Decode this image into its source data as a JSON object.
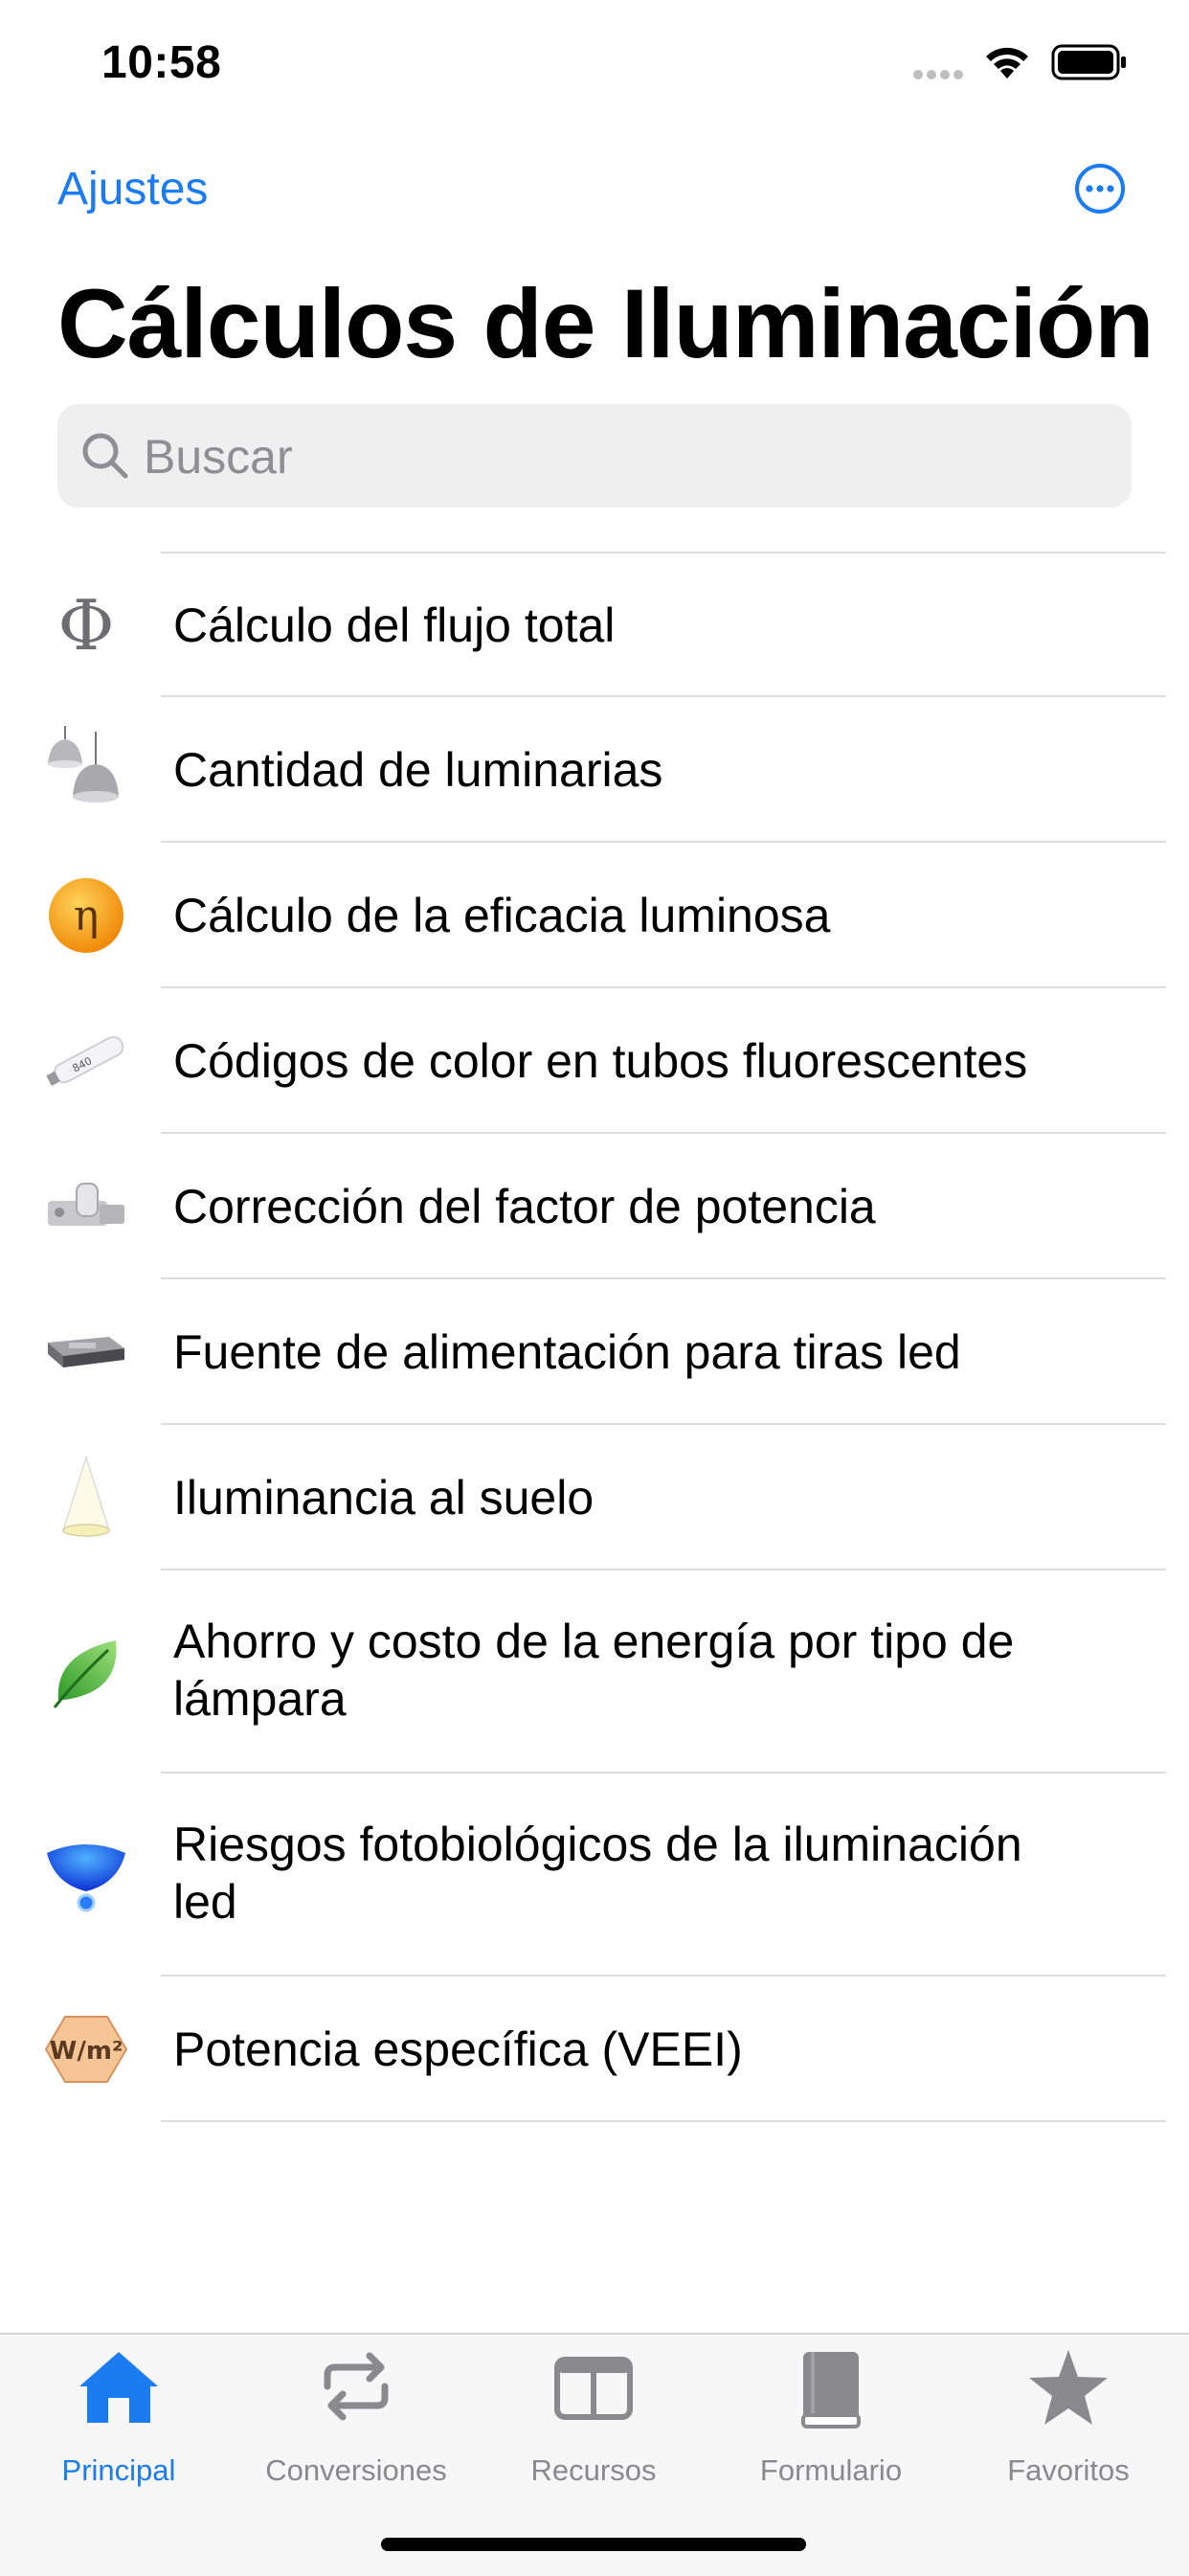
{
  "status_bar": {
    "time": "10:58"
  },
  "nav": {
    "settings_label": "Ajustes",
    "more_icon": "ellipsis-circle-icon"
  },
  "title": "Cálculos de Iluminación",
  "search": {
    "placeholder": "Buscar",
    "value": ""
  },
  "list": [
    {
      "label": "Cálculo del flujo total",
      "icon": "phi-icon",
      "icon_text": "Φ"
    },
    {
      "label": "Cantidad de luminarias",
      "icon": "pendant-lamps-icon"
    },
    {
      "label": "Cálculo de la eficacia luminosa",
      "icon": "eta-icon",
      "icon_text": "η"
    },
    {
      "label": "Códigos de color en tubos fluorescentes",
      "icon": "fluorescent-tube-icon",
      "icon_text": "840"
    },
    {
      "label": "Corrección del factor de potencia",
      "icon": "capacitor-icon"
    },
    {
      "label": "Fuente de alimentación para tiras led",
      "icon": "power-supply-icon"
    },
    {
      "label": "Iluminancia al suelo",
      "icon": "light-cone-icon"
    },
    {
      "label": "Ahorro y costo de la energía por tipo de lámpara",
      "icon": "leaf-icon"
    },
    {
      "label": "Riesgos fotobiológicos de la iluminación led",
      "icon": "led-icon"
    },
    {
      "label": "Potencia específica (VEEI)",
      "icon": "power-density-icon",
      "icon_text": "W/m²"
    }
  ],
  "tabs": [
    {
      "label": "Principal",
      "icon": "house-icon",
      "active": true
    },
    {
      "label": "Conversiones",
      "icon": "repeat-icon",
      "active": false
    },
    {
      "label": "Recursos",
      "icon": "panels-icon",
      "active": false
    },
    {
      "label": "Formulario",
      "icon": "book-icon",
      "active": false
    },
    {
      "label": "Favoritos",
      "icon": "star-icon",
      "active": false
    }
  ],
  "colors": {
    "accent": "#1a7cf0",
    "inactive": "#8a8a8e"
  }
}
